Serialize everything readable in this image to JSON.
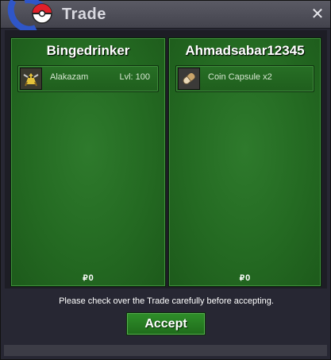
{
  "window": {
    "title": "Trade",
    "close_label": "✕"
  },
  "left_panel": {
    "player": "Bingedrinker",
    "item": {
      "name": "Alakazam",
      "level": "Lvl: 100",
      "icon": "alakazam-icon"
    },
    "money_symbol": "₽",
    "money": "0"
  },
  "right_panel": {
    "player": "Ahmadsabar12345",
    "item": {
      "name": "Coin Capsule",
      "quantity": "x2",
      "icon": "coin-capsule-icon"
    },
    "money_symbol": "₽",
    "money": "0"
  },
  "notice": "Please check over the Trade carefully before accepting.",
  "accept_label": "Accept"
}
